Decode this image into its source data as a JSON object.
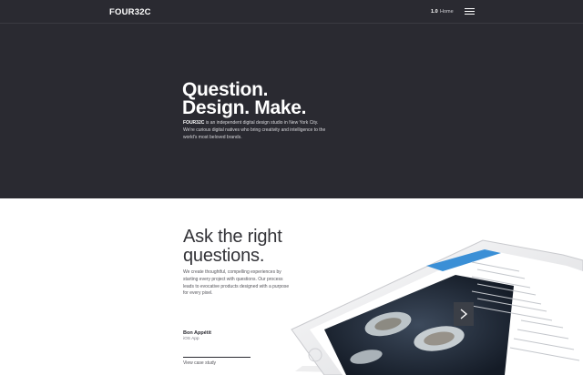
{
  "nav": {
    "logo": "FOUR32C",
    "page_number": "1.0",
    "current_page": "Home"
  },
  "hero": {
    "title_line1": "Question.",
    "title_line2": "Design. Make.",
    "brand": "FOUR32C",
    "description": " is an independent digital design studio in New York City. We're curious digital natives who bring creativity and intelligence to the world's most beloved brands."
  },
  "section": {
    "title_line1": "Ask the right",
    "title_line2": "questions.",
    "description": "We create thoughtful, compelling experiences by starting every project with questions. Our process leads to evocative products designed with a purpose for every pixel.",
    "case_study": {
      "name": "Bon Appétit",
      "type": "iOS App",
      "link_label": "View case study"
    }
  },
  "colors": {
    "dark_background": "#2a2a31",
    "light_background": "#ffffff",
    "heading_dark": "#333338"
  },
  "icons": {
    "menu": "hamburger-menu-icon",
    "next": "chevron-right-icon"
  }
}
